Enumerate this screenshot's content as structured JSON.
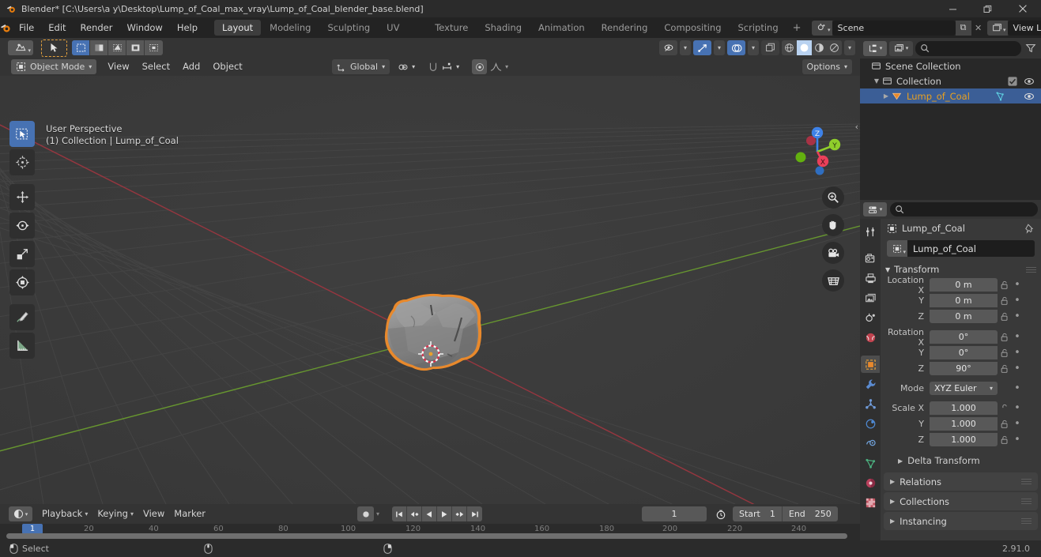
{
  "window": {
    "title": "Blender* [C:\\Users\\a y\\Desktop\\Lump_of_Coal_max_vray\\Lump_of_Coal_blender_base.blend]",
    "minimize": "—",
    "maximize": "❐",
    "close": "✕"
  },
  "topbar": {
    "menus": [
      "File",
      "Edit",
      "Render",
      "Window",
      "Help"
    ],
    "workspaces": [
      {
        "label": "Layout",
        "active": true
      },
      {
        "label": "Modeling",
        "active": false
      },
      {
        "label": "Sculpting",
        "active": false
      },
      {
        "label": "UV Editing",
        "active": false
      },
      {
        "label": "Texture Paint",
        "active": false
      },
      {
        "label": "Shading",
        "active": false
      },
      {
        "label": "Animation",
        "active": false
      },
      {
        "label": "Rendering",
        "active": false
      },
      {
        "label": "Compositing",
        "active": false
      },
      {
        "label": "Scripting",
        "active": false
      }
    ],
    "add_workspace": "+",
    "scene_name": "Scene",
    "viewlayer_name": "View Layer",
    "new_button": "⧉",
    "unlink_button": "✕"
  },
  "viewport": {
    "mode": "Object Mode",
    "menus": [
      "View",
      "Select",
      "Add",
      "Object"
    ],
    "orientation": "Global",
    "options_label": "Options",
    "overlay_text_line1": "User Perspective",
    "overlay_text_line2": "(1) Collection | Lump_of_Coal",
    "gizmo_axes": [
      {
        "label": "Z",
        "color": "#3e82e8"
      },
      {
        "label": "Y",
        "color": "#8fce2b"
      },
      {
        "label": "X",
        "color": "#e9405a"
      }
    ],
    "tools": [
      "select-box-tool",
      "cursor-tool",
      "move-tool",
      "rotate-tool",
      "scale-tool",
      "transform-tool",
      "annotate-tool",
      "measure-tool"
    ],
    "nav_buttons": [
      "zoom-icon",
      "pan-hand-icon",
      "camera-icon",
      "grid-ortho-icon"
    ],
    "object_name": "Lump_of_Coal",
    "outline_color": "#e8892c"
  },
  "outliner": {
    "search_placeholder": "",
    "rows": [
      {
        "label": "Scene Collection",
        "indent": 0,
        "icon": "collection-icon",
        "expander": "",
        "selected": false,
        "checkbox": false,
        "eye": false
      },
      {
        "label": "Collection",
        "indent": 1,
        "icon": "collection-icon",
        "expander": "▼",
        "selected": false,
        "checkbox": true,
        "eye": true
      },
      {
        "label": "Lump_of_Coal",
        "indent": 2,
        "icon": "mesh-object-icon",
        "expander": "▶",
        "selected": true,
        "checkbox": false,
        "eye": true
      }
    ]
  },
  "properties": {
    "search_placeholder": "",
    "tabs": [
      {
        "name": "tool-tab",
        "active": false
      },
      {
        "name": "render-tab",
        "active": false
      },
      {
        "name": "output-tab",
        "active": false
      },
      {
        "name": "view-layer-tab",
        "active": false
      },
      {
        "name": "scene-tab",
        "active": false
      },
      {
        "name": "world-tab",
        "active": false
      },
      {
        "name": "object-tab",
        "active": true
      },
      {
        "name": "modifier-tab",
        "active": false
      },
      {
        "name": "particles-tab",
        "active": false
      },
      {
        "name": "physics-tab",
        "active": false
      },
      {
        "name": "constraints-tab",
        "active": false
      },
      {
        "name": "object-data-tab",
        "active": false
      },
      {
        "name": "material-tab",
        "active": false
      },
      {
        "name": "texture-tab",
        "active": false
      }
    ],
    "breadcrumb": "Lump_of_Coal",
    "object_name_field": "Lump_of_Coal",
    "transform_panel": "Transform",
    "rows": [
      {
        "label": "Location X",
        "value": "0 m"
      },
      {
        "label": "Y",
        "value": "0 m"
      },
      {
        "label": "Z",
        "value": "0 m"
      },
      {
        "label": "Rotation X",
        "value": "0°"
      },
      {
        "label": "Y",
        "value": "0°"
      },
      {
        "label": "Z",
        "value": "90°"
      },
      {
        "label": "Scale X",
        "value": "1.000"
      },
      {
        "label": "Y",
        "value": "1.000"
      },
      {
        "label": "Z",
        "value": "1.000"
      }
    ],
    "mode_label": "Mode",
    "mode_value": "XYZ Euler",
    "delta_transform": "Delta Transform",
    "closed_panels": [
      "Relations",
      "Collections",
      "Instancing"
    ]
  },
  "timeline": {
    "menus": [
      "Playback",
      "Keying",
      "View",
      "Marker"
    ],
    "current_frame": "1",
    "start_label": "Start",
    "start_value": "1",
    "end_label": "End",
    "end_value": "250",
    "playhead_frame": "1",
    "ticks": [
      "20",
      "40",
      "60",
      "80",
      "100",
      "120",
      "140",
      "160",
      "180",
      "200",
      "220",
      "240"
    ]
  },
  "statusbar": {
    "mouse_left_action": "Select",
    "version": "2.91.0"
  }
}
